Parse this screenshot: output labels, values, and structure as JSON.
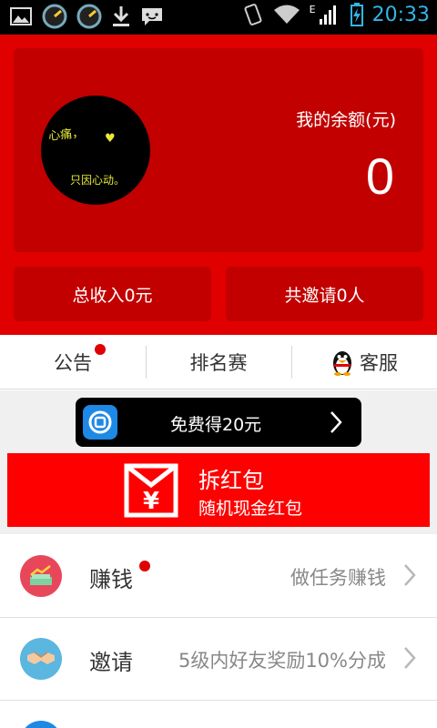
{
  "status_bar": {
    "time": "20:33",
    "network": "E"
  },
  "profile": {
    "avatar_text_1": "心痛，",
    "avatar_text_2": "只因心动。",
    "balance_label": "我的余额(元)",
    "balance_value": "0",
    "total_income": "总收入0元",
    "total_invites": "共邀请0人"
  },
  "tabs": [
    {
      "label": "公告",
      "has_dot": true
    },
    {
      "label": "排名赛"
    },
    {
      "label": "客服",
      "icon": "qq-penguin-icon"
    }
  ],
  "promo": {
    "label": "免费得20元",
    "icon": "app-icon"
  },
  "red_packet": {
    "title": "拆红包",
    "subtitle": "随机现金红包",
    "icon": "red-envelope-yen-icon"
  },
  "list": [
    {
      "title": "赚钱",
      "desc": "做任务赚钱",
      "has_dot": true,
      "icon": "money-chart-icon",
      "icon_color": "#e8475b"
    },
    {
      "title": "邀请",
      "desc": "5级内好友奖励10%分成",
      "icon": "handshake-icon",
      "icon_color": "#5bb6e0"
    }
  ],
  "colors": {
    "header_red": "#e00000",
    "card_red": "#c20000",
    "accent_red": "#ff0000",
    "time_blue": "#33b5e5"
  }
}
